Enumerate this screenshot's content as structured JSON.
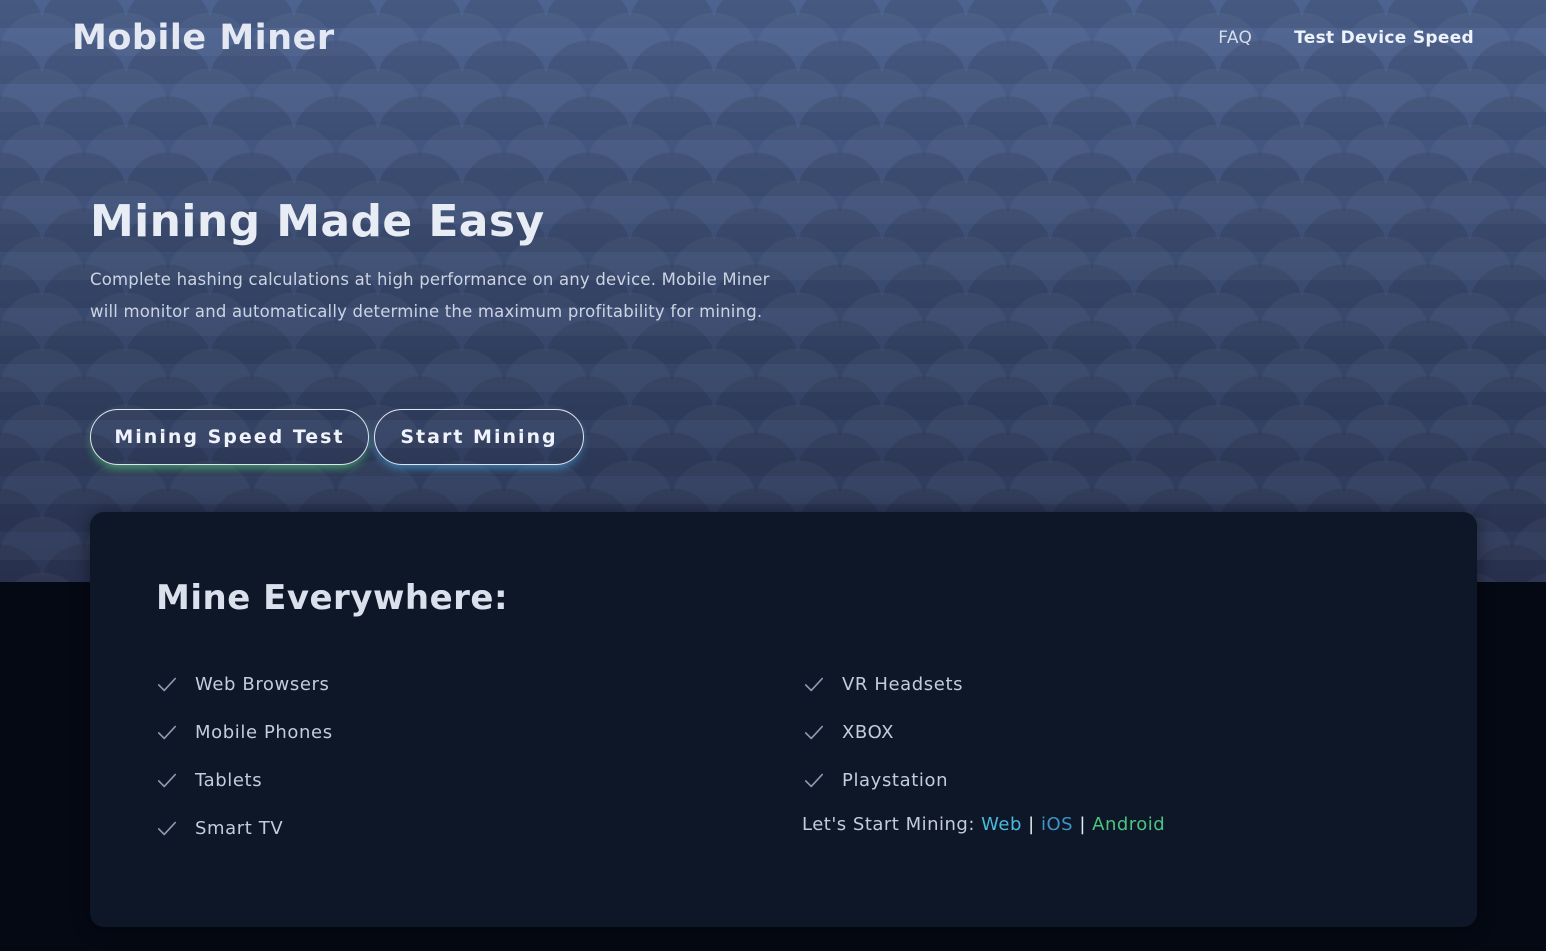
{
  "header": {
    "brand": "Mobile Miner",
    "nav": {
      "faq": "FAQ",
      "test_speed": "Test Device Speed"
    }
  },
  "hero": {
    "title": "Mining Made Easy",
    "description": "Complete hashing calculations at high performance on any device. Mobile Miner will monitor and automatically determine the maximum profitability for mining.",
    "buttons": {
      "speed_test": "Mining Speed Test",
      "start_mining": "Start Mining"
    }
  },
  "card": {
    "title": "Mine Everywhere:",
    "left_items": [
      "Web Browsers",
      "Mobile Phones",
      "Tablets",
      "Smart TV"
    ],
    "right_items": [
      "VR Headsets",
      "XBOX",
      "Playstation"
    ],
    "start": {
      "label": "Let's Start Mining:",
      "web": "Web",
      "ios": "iOS",
      "android": "Android",
      "separator": "|"
    }
  },
  "colors": {
    "check": "#8f9bb0",
    "web_link": "#49b9dc",
    "ios_link": "#3f93c9",
    "android_link": "#49c581",
    "speed_glow": "#50d278",
    "start_glow": "#46aae6"
  },
  "icons": {
    "feature_bullet": "check-icon"
  }
}
